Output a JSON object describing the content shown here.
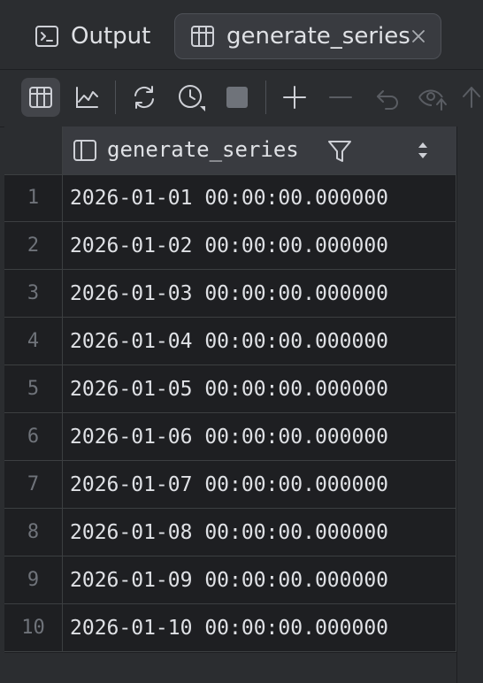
{
  "tabs": [
    {
      "label": "Output",
      "icon": "terminal-icon",
      "active": false
    },
    {
      "label": "generate_series",
      "icon": "table-icon",
      "active": true,
      "closable": true
    }
  ],
  "toolbar": {
    "buttons": [
      {
        "name": "table-view-button",
        "icon": "table-icon",
        "active": true
      },
      {
        "name": "chart-view-button",
        "icon": "chart-icon"
      },
      {
        "name": "refresh-button",
        "icon": "refresh-icon"
      },
      {
        "name": "history-button",
        "icon": "clock-icon"
      },
      {
        "name": "stop-button",
        "icon": "stop-icon"
      },
      {
        "name": "add-row-button",
        "icon": "plus-icon"
      },
      {
        "name": "delete-row-button",
        "icon": "minus-icon"
      },
      {
        "name": "revert-button",
        "icon": "undo-icon"
      },
      {
        "name": "preview-changes-button",
        "icon": "eye-upload-icon"
      },
      {
        "name": "submit-button",
        "icon": "arrow-up-icon"
      }
    ]
  },
  "grid": {
    "column": {
      "name": "generate_series"
    },
    "rows": [
      {
        "n": "1",
        "value": "2026-01-01 00:00:00.000000"
      },
      {
        "n": "2",
        "value": "2026-01-02 00:00:00.000000"
      },
      {
        "n": "3",
        "value": "2026-01-03 00:00:00.000000"
      },
      {
        "n": "4",
        "value": "2026-01-04 00:00:00.000000"
      },
      {
        "n": "5",
        "value": "2026-01-05 00:00:00.000000"
      },
      {
        "n": "6",
        "value": "2026-01-06 00:00:00.000000"
      },
      {
        "n": "7",
        "value": "2026-01-07 00:00:00.000000"
      },
      {
        "n": "8",
        "value": "2026-01-08 00:00:00.000000"
      },
      {
        "n": "9",
        "value": "2026-01-09 00:00:00.000000"
      },
      {
        "n": "10",
        "value": "2026-01-10 00:00:00.000000"
      }
    ]
  },
  "colors": {
    "background": "#2b2d30",
    "grid_background": "#1e1f22",
    "text": "#dfe1e5",
    "muted": "#6f737a",
    "active_button": "#43454a"
  }
}
